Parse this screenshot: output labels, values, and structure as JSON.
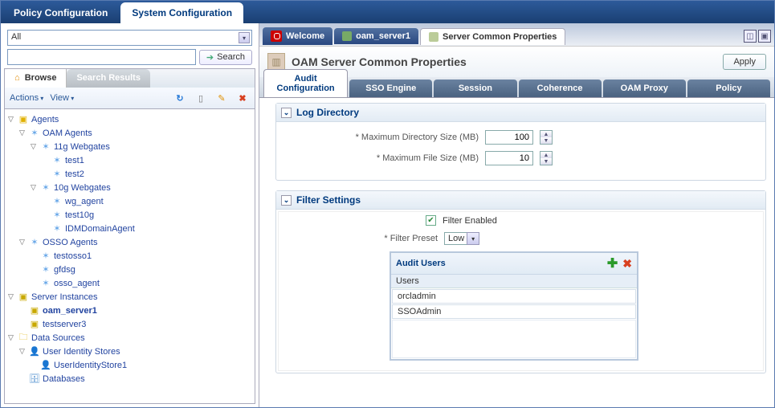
{
  "mainTabs": {
    "policy": "Policy Configuration",
    "system": "System Configuration"
  },
  "search": {
    "all": "All",
    "button": "Search"
  },
  "browseTabs": {
    "browse": "Browse",
    "results": "Search Results"
  },
  "toolbar": {
    "actions": "Actions",
    "view": "View"
  },
  "tree": {
    "agents": "Agents",
    "oamAgents": "OAM Agents",
    "wg11": "11g Webgates",
    "test1": "test1",
    "test2": "test2",
    "wg10": "10g Webgates",
    "wg_agent": "wg_agent",
    "test10g": "test10g",
    "idm": "IDMDomainAgent",
    "osso": "OSSO Agents",
    "testosso1": "testosso1",
    "gfdsg": "gfdsg",
    "osso_agent": "osso_agent",
    "serverInst": "Server Instances",
    "oam_server1": "oam_server1",
    "testserver3": "testserver3",
    "dataSources": "Data Sources",
    "userIdStores": "User Identity Stores",
    "userIdStore1": "UserIdentityStore1",
    "databases": "Databases"
  },
  "contentTabs": {
    "welcome": "Welcome",
    "oam": "oam_server1",
    "common": "Server Common Properties"
  },
  "pageTitle": "OAM Server Common Properties",
  "apply": "Apply",
  "cfgTabs": {
    "audit": "Audit Configuration",
    "sso": "SSO Engine",
    "session": "Session",
    "coherence": "Coherence",
    "proxy": "OAM Proxy",
    "policy": "Policy"
  },
  "logDir": {
    "title": "Log Directory",
    "maxDir": "Maximum Directory Size (MB)",
    "maxDirVal": "100",
    "maxFile": "Maximum File Size (MB)",
    "maxFileVal": "10"
  },
  "filter": {
    "title": "Filter Settings",
    "enabled": "Filter Enabled",
    "preset": "Filter Preset",
    "presetVal": "Low"
  },
  "audit": {
    "title": "Audit Users",
    "usersLabel": "Users",
    "u1": "orcladmin",
    "u2": "SSOAdmin"
  }
}
